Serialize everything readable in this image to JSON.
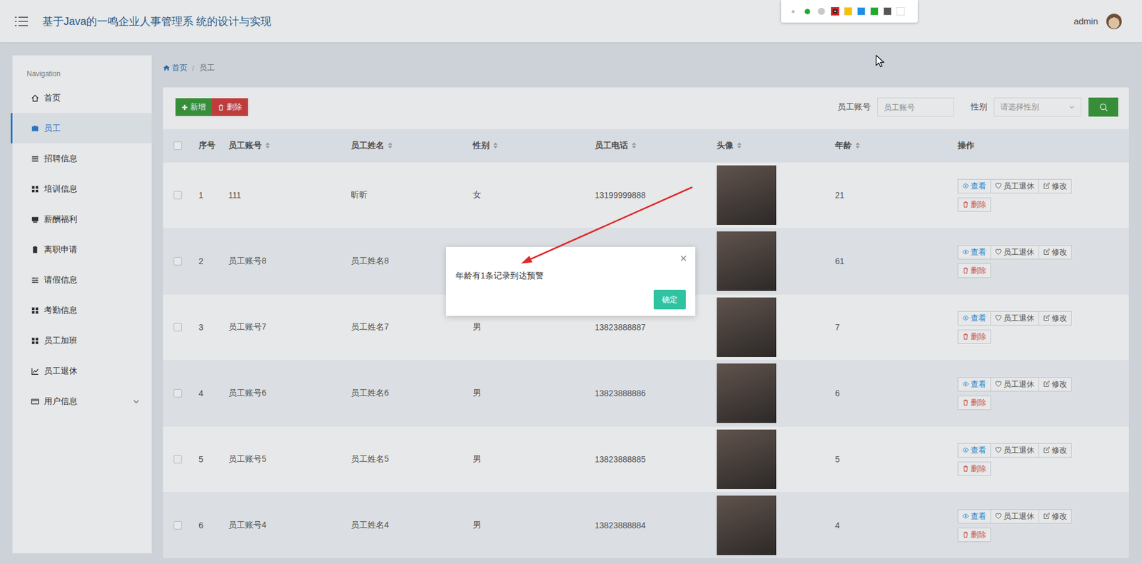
{
  "header": {
    "title": "基于Java的一鸣企业人事管理系 统的设计与实现",
    "user": "admin"
  },
  "annotation_toolbar": {
    "pen_sizes": [
      {
        "kind": "small",
        "selected": false,
        "color": "#bdbdbd"
      },
      {
        "kind": "medium",
        "selected": true,
        "color": "#1faa2a"
      },
      {
        "kind": "large",
        "selected": false,
        "color": "#c9c9c9"
      }
    ],
    "colors": [
      {
        "color": "#d92626",
        "selected": true
      },
      {
        "color": "#f6c000",
        "selected": false
      },
      {
        "color": "#1e8fe6",
        "selected": false
      },
      {
        "color": "#1faa2a",
        "selected": false
      },
      {
        "color": "#555555",
        "selected": false
      },
      {
        "color": "#ffffff",
        "selected": false
      }
    ]
  },
  "sidebar": {
    "heading": "Navigation",
    "items": [
      {
        "label": "首页",
        "selected": false,
        "kind": "link",
        "expanded": false
      },
      {
        "label": "员工",
        "selected": true,
        "kind": "link",
        "expanded": false
      },
      {
        "label": "招聘信息",
        "selected": false,
        "kind": "link",
        "expanded": false
      },
      {
        "label": "培训信息",
        "selected": false,
        "kind": "link",
        "expanded": false
      },
      {
        "label": "薪酬福利",
        "selected": false,
        "kind": "link",
        "expanded": false
      },
      {
        "label": "离职申请",
        "selected": false,
        "kind": "link",
        "expanded": false
      },
      {
        "label": "请假信息",
        "selected": false,
        "kind": "link",
        "expanded": false
      },
      {
        "label": "考勤信息",
        "selected": false,
        "kind": "link",
        "expanded": false
      },
      {
        "label": "员工加班",
        "selected": false,
        "kind": "link",
        "expanded": false
      },
      {
        "label": "员工退休",
        "selected": false,
        "kind": "link",
        "expanded": false
      },
      {
        "label": "用户信息",
        "selected": false,
        "kind": "group",
        "expanded": false
      }
    ]
  },
  "breadcrumb": {
    "items": [
      "首页",
      "员工"
    ],
    "separator": "/"
  },
  "toolbar": {
    "add": "新增",
    "delete": "删除"
  },
  "search": {
    "fields": [
      {
        "label": "员工账号",
        "placeholder": "员工账号",
        "kind": "input"
      },
      {
        "label": "性别",
        "placeholder": "请选择性别",
        "kind": "select"
      }
    ]
  },
  "table": {
    "all_checked": false,
    "columns": [
      {
        "label": "序号",
        "sortable": false
      },
      {
        "label": "员工账号",
        "sortable": true
      },
      {
        "label": "员工姓名",
        "sortable": true
      },
      {
        "label": "性别",
        "sortable": true
      },
      {
        "label": "员工电话",
        "sortable": true
      },
      {
        "label": "头像",
        "sortable": true
      },
      {
        "label": "年龄",
        "sortable": true
      },
      {
        "label": "操作",
        "sortable": false
      }
    ],
    "actions": [
      "查看",
      "员工退休",
      "修改",
      "删除"
    ],
    "rows": [
      {
        "checked": false,
        "index": "1",
        "account": "111",
        "name": "昕昕",
        "gender": "女",
        "phone": "13199999888",
        "age": "21"
      },
      {
        "checked": false,
        "index": "2",
        "account": "员工账号8",
        "name": "员工姓名8",
        "gender": "",
        "phone": "",
        "age": "61"
      },
      {
        "checked": false,
        "index": "3",
        "account": "员工账号7",
        "name": "员工姓名7",
        "gender": "男",
        "phone": "13823888887",
        "age": "7"
      },
      {
        "checked": false,
        "index": "4",
        "account": "员工账号6",
        "name": "员工姓名6",
        "gender": "男",
        "phone": "13823888886",
        "age": "6"
      },
      {
        "checked": false,
        "index": "5",
        "account": "员工账号5",
        "name": "员工姓名5",
        "gender": "男",
        "phone": "13823888885",
        "age": "5"
      },
      {
        "checked": false,
        "index": "6",
        "account": "员工账号4",
        "name": "员工姓名4",
        "gender": "男",
        "phone": "13823888884",
        "age": "4"
      }
    ]
  },
  "dialog": {
    "message": "年龄有1条记录到达预警",
    "close": "×",
    "confirm": "确定"
  }
}
